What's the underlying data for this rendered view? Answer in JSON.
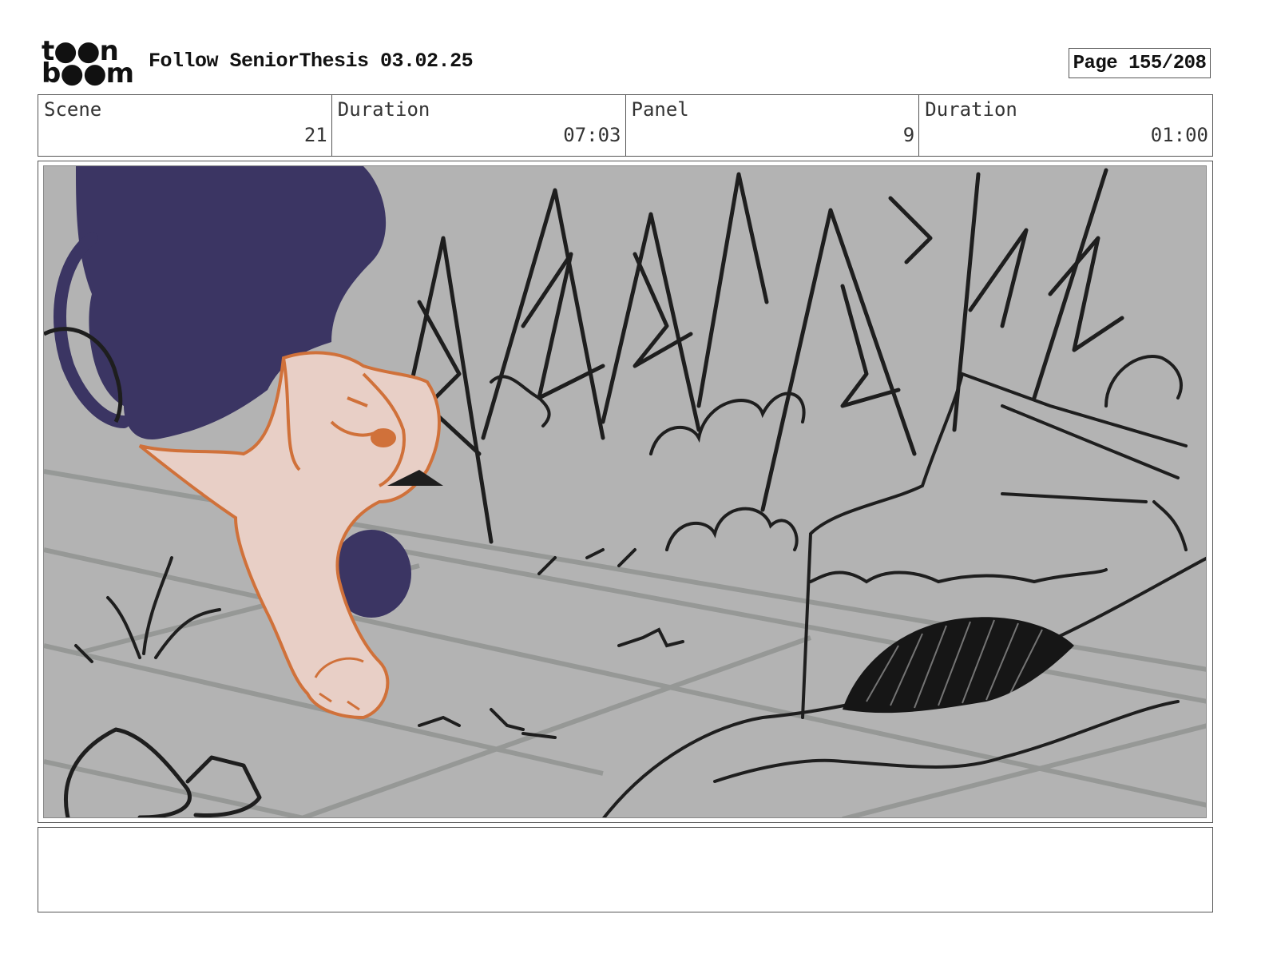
{
  "header": {
    "logo_line1": "t●●n",
    "logo_line2": "b●●m",
    "title": "Follow SeniorThesis 03.02.25",
    "page_label": "Page 155/208"
  },
  "info": {
    "scene_label": "Scene",
    "scene_value": "21",
    "scene_duration_label": "Duration",
    "scene_duration_value": "07:03",
    "panel_label": "Panel",
    "panel_value": "9",
    "panel_duration_label": "Duration",
    "panel_duration_value": "01:00"
  },
  "notes": {
    "text": ""
  },
  "colors": {
    "panel_background": "#b3b3b3",
    "creature_dark": "#3b3563",
    "dog_fill": "#e8cfc6",
    "dog_outline": "#d0713a",
    "line_art": "#1e1e1e"
  }
}
